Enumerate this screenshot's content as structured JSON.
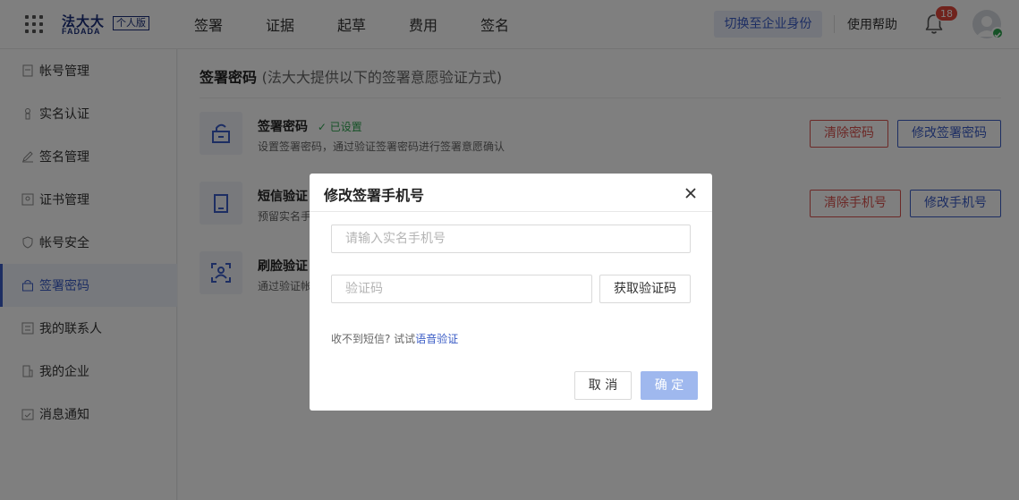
{
  "header": {
    "logo_text": "法大大",
    "logo_sub": "FADADA",
    "logo_badge": "个人版",
    "nav": [
      "签署",
      "证据",
      "起草",
      "费用",
      "签名"
    ],
    "switch_label": "切换至企业身份",
    "help_label": "使用帮助",
    "notification_count": "18",
    "icons": {
      "apps": "grid-icon",
      "bell": "bell-icon",
      "avatar": "avatar",
      "verified": "check-badge-icon"
    }
  },
  "sidebar": {
    "active_index": 5,
    "items": [
      {
        "label": "帐号管理",
        "icon": "account-icon"
      },
      {
        "label": "实名认证",
        "icon": "id-icon"
      },
      {
        "label": "签名管理",
        "icon": "pen-icon"
      },
      {
        "label": "证书管理",
        "icon": "certificate-icon"
      },
      {
        "label": "帐号安全",
        "icon": "shield-icon"
      },
      {
        "label": "签署密码",
        "icon": "lock-icon"
      },
      {
        "label": "我的联系人",
        "icon": "contacts-icon"
      },
      {
        "label": "我的企业",
        "icon": "building-icon"
      },
      {
        "label": "消息通知",
        "icon": "calendar-icon"
      }
    ]
  },
  "main": {
    "title": "签署密码",
    "subtitle": "(法大大提供以下的签署意愿验证方式)",
    "rows": [
      {
        "title": "签署密码",
        "status": "已设置",
        "desc": "设置签署密码，通过验证签署密码进行签署意愿确认",
        "btn1": "清除密码",
        "btn2": "修改签署密码",
        "icon": "unlock-icon"
      },
      {
        "title": "短信验证",
        "desc": "预留实名手",
        "btn1": "清除手机号",
        "btn2": "修改手机号",
        "icon": "phone-icon"
      },
      {
        "title": "刷脸验证",
        "desc": "通过验证帐",
        "icon": "face-scan-icon"
      }
    ]
  },
  "modal": {
    "title": "修改签署手机号",
    "phone_placeholder": "请输入实名手机号",
    "code_placeholder": "验证码",
    "get_code_label": "获取验证码",
    "hint_text": "收不到短信?  试试",
    "hint_link": "语音验证",
    "cancel_label": "取 消",
    "ok_label": "确 定"
  },
  "colors": {
    "brand": "#1b2f7a",
    "accent": "#3b5cc6",
    "danger": "#d9534f",
    "success": "#2da44e",
    "disabled_primary": "#9fb8ee"
  }
}
